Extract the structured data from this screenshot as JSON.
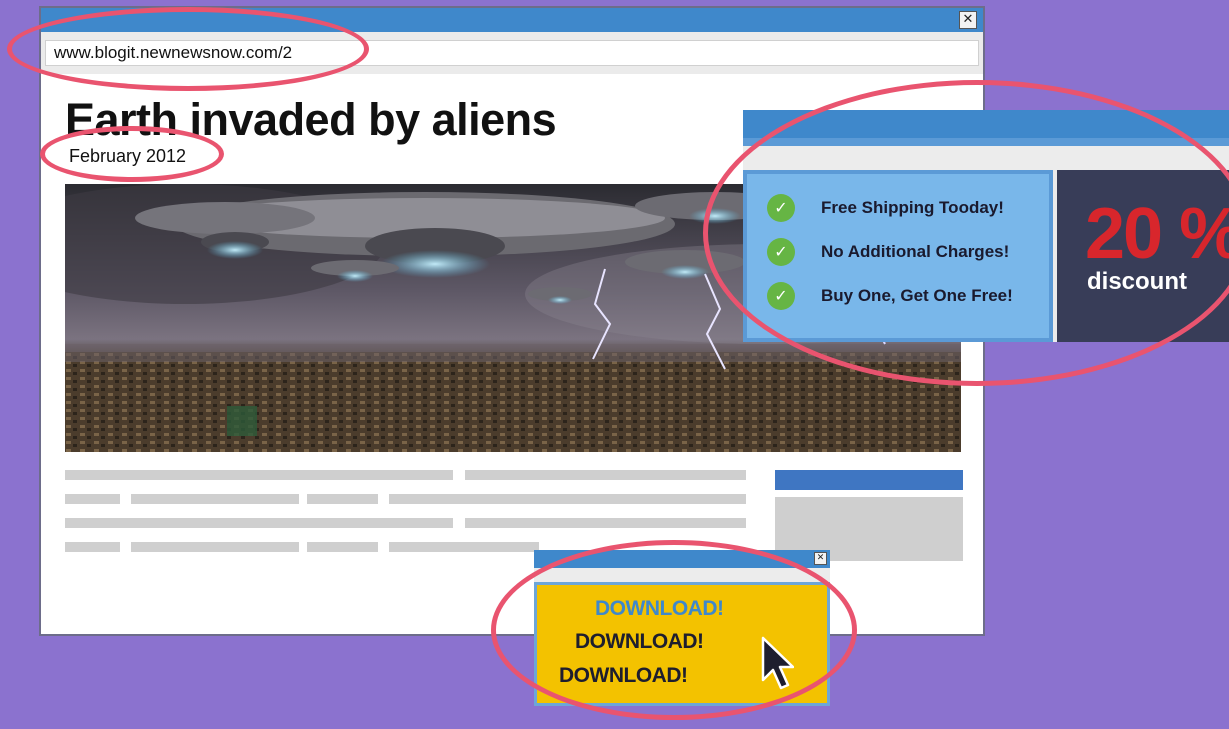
{
  "browser": {
    "url": "www.blogit.newnewsnow.com/2",
    "close_label": "✕",
    "article": {
      "headline": "Earth invaded by aliens",
      "date": "February 2012"
    }
  },
  "ad_popup": {
    "features": [
      "Free Shipping Tooday!",
      "No Additional Charges!",
      "Buy One, Get One Free!"
    ],
    "check_glyph": "✓",
    "discount_value": "20 %",
    "discount_label": "discount"
  },
  "download_popup": {
    "close_label": "✕",
    "lines": [
      "DOWNLOAD!",
      "DOWNLOAD!",
      "DOWNLOAD!"
    ]
  },
  "colors": {
    "background": "#8b72cf",
    "titlebar_blue": "#3f88cb",
    "highlight_ring": "#e9546f",
    "ad_green_check": "#66b544",
    "discount_red": "#d8262c",
    "download_yellow": "#f3c200",
    "download_blue_text": "#3f88cb"
  },
  "icons": {
    "cursor": "arrow-cursor-icon",
    "close": "close-icon",
    "check": "check-circle-icon"
  }
}
